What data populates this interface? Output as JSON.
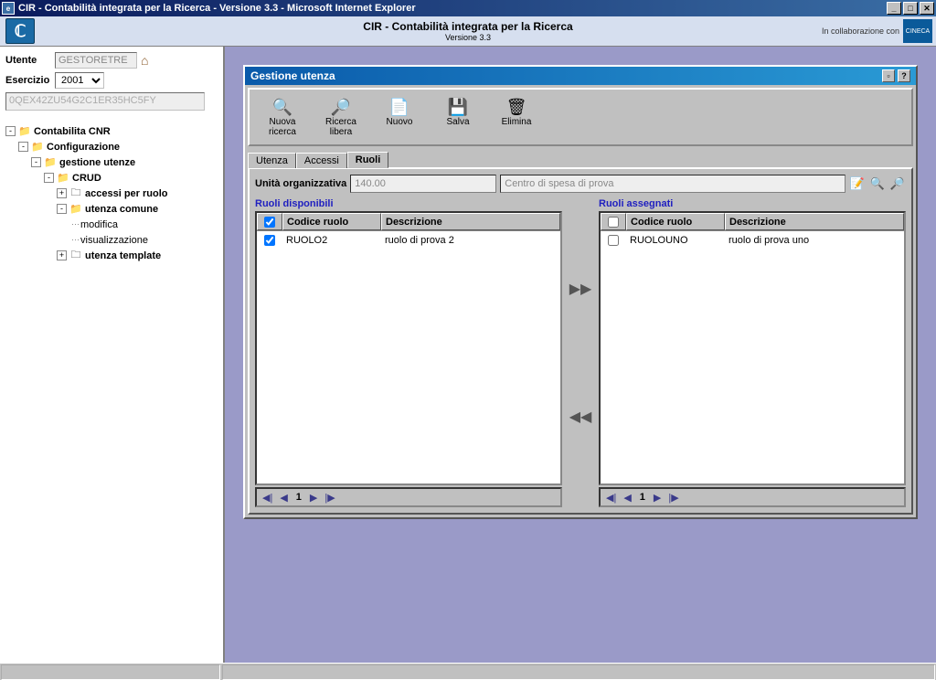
{
  "window": {
    "title": "CIR - Contabilità integrata per la Ricerca - Versione 3.3 - Microsoft Internet Explorer"
  },
  "header": {
    "title": "CIR - Contabilità integrata per la Ricerca",
    "subtitle": "Versione 3.3",
    "collab": "In collaborazione con",
    "partner": "CINECA"
  },
  "sidebar": {
    "user_label": "Utente",
    "user_value": "GESTORETRE",
    "year_label": "Esercizio",
    "year_value": "2001",
    "license": "0QEX42ZU54G2C1ER35HC5FY",
    "tree": [
      {
        "indent": 0,
        "toggle": "-",
        "icon": "📁",
        "label": "Contabilita CNR",
        "bold": true
      },
      {
        "indent": 1,
        "toggle": "-",
        "icon": "📁",
        "label": "Configurazione",
        "bold": true
      },
      {
        "indent": 2,
        "toggle": "-",
        "icon": "📁",
        "label": "gestione utenze",
        "bold": true
      },
      {
        "indent": 3,
        "toggle": "-",
        "icon": "📁",
        "label": "CRUD",
        "bold": true
      },
      {
        "indent": 4,
        "toggle": "+",
        "icon": "🗀",
        "label": "accessi per ruolo",
        "bold": true
      },
      {
        "indent": 4,
        "toggle": "-",
        "icon": "📁",
        "label": "utenza comune",
        "bold": true
      },
      {
        "indent": 5,
        "toggle": "",
        "icon": "",
        "label": "modifica",
        "bold": false
      },
      {
        "indent": 5,
        "toggle": "",
        "icon": "",
        "label": "visualizzazione",
        "bold": false
      },
      {
        "indent": 4,
        "toggle": "+",
        "icon": "🗀",
        "label": "utenza template",
        "bold": true
      }
    ]
  },
  "panel": {
    "title": "Gestione utenza",
    "toolbar": [
      {
        "icon": "🔍",
        "label": "Nuova ricerca"
      },
      {
        "icon": "🔎",
        "label": "Ricerca libera"
      },
      {
        "icon": "📄",
        "label": "Nuovo"
      },
      {
        "icon": "💾",
        "label": "Salva"
      },
      {
        "icon": "🗑",
        "label": "Elimina"
      }
    ],
    "tabs": [
      "Utenza",
      "Accessi",
      "Ruoli"
    ],
    "active_tab": "Ruoli",
    "unit_label": "Unità organizzativa",
    "unit_code": "140.00",
    "unit_desc": "Centro di spesa di prova",
    "available": {
      "title": "Ruoli disponibili",
      "cols": {
        "code": "Codice ruolo",
        "desc": "Descrizione"
      },
      "rows": [
        {
          "checked": true,
          "code": "RUOLO2",
          "desc": "ruolo di prova 2"
        }
      ],
      "page": "1"
    },
    "assigned": {
      "title": "Ruoli assegnati",
      "cols": {
        "code": "Codice ruolo",
        "desc": "Descrizione"
      },
      "rows": [
        {
          "checked": false,
          "code": "RUOLOUNO",
          "desc": "ruolo di prova uno"
        }
      ],
      "page": "1"
    }
  }
}
